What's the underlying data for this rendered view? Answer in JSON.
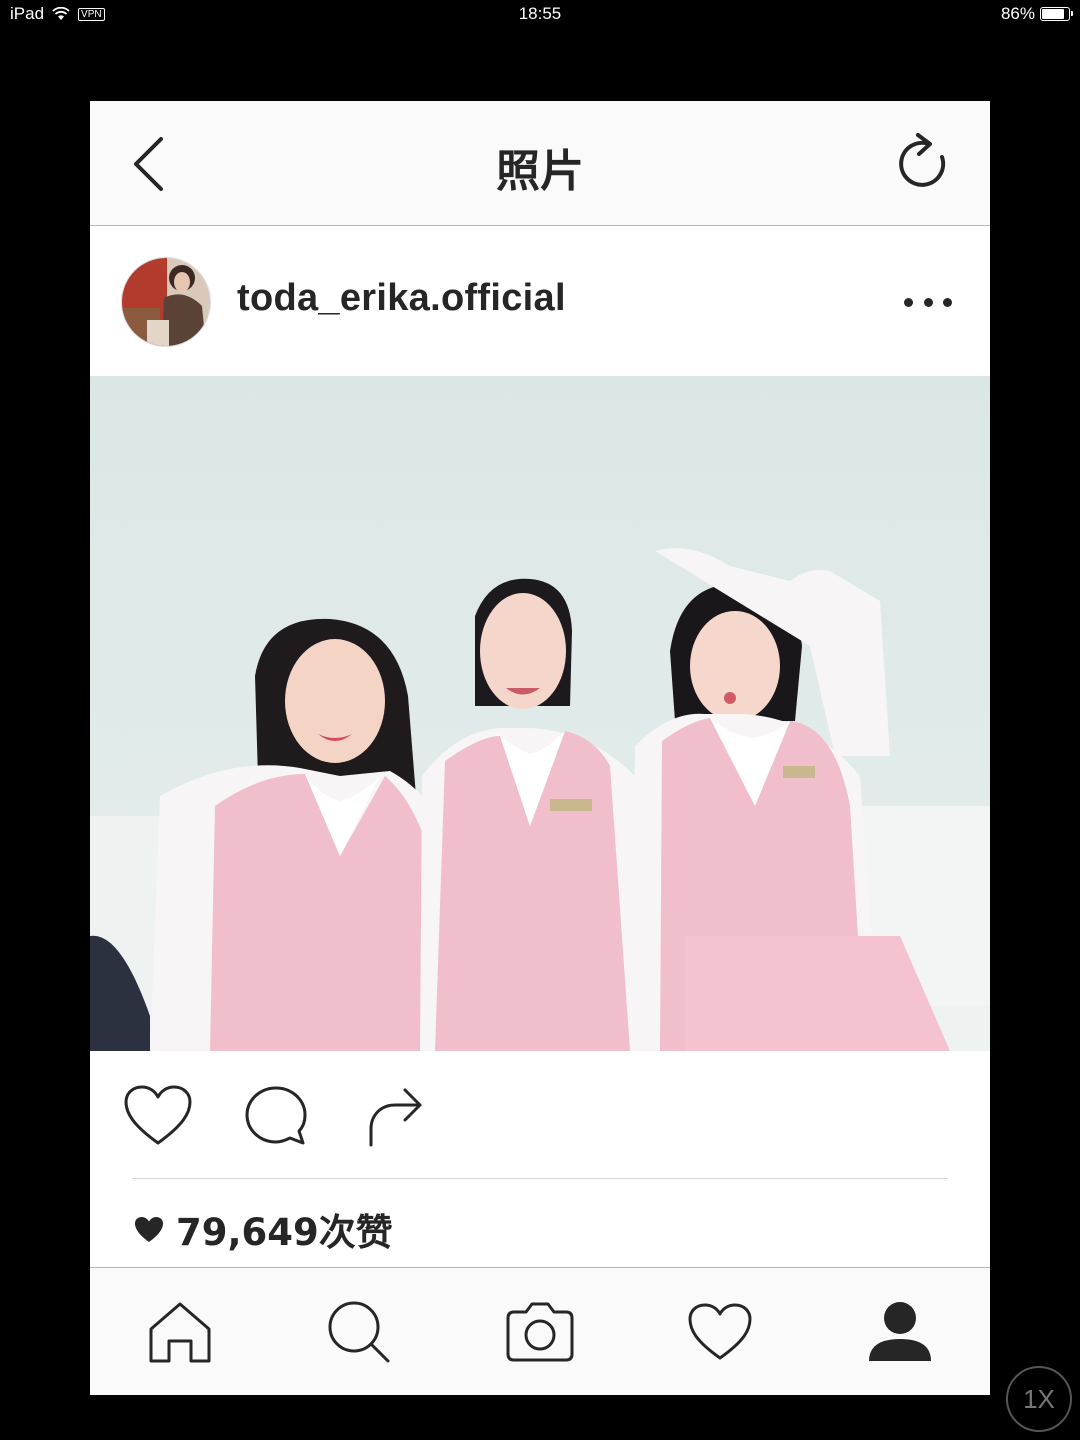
{
  "status_bar": {
    "device": "iPad",
    "vpn": "VPN",
    "time": "18:55",
    "battery": "86%",
    "battery_level": 0.86
  },
  "nav": {
    "title": "照片",
    "back_icon": "chevron-left-icon",
    "refresh_icon": "refresh-icon"
  },
  "post": {
    "username": "toda_erika.official",
    "avatar_icon": "profile-photo",
    "more_icon": "ellipsis-icon",
    "photo_description": "Photo of three women in pink vests and white blouses seated against a pale wall"
  },
  "actions": {
    "like_icon": "heart-outline-icon",
    "comment_icon": "comment-bubble-icon",
    "share_icon": "share-arrow-icon"
  },
  "likes": {
    "text": "79,649次赞",
    "icon": "heart-filled-icon"
  },
  "tab_bar": {
    "items": [
      "home-icon",
      "search-icon",
      "camera-icon",
      "activity-heart-icon",
      "profile-icon"
    ]
  },
  "overlay": {
    "speed": "1X"
  },
  "colors": {
    "frame_bg": "#ffffff",
    "bar_bg": "#fafafa",
    "text": "#262626",
    "vest_pink": "#f1bfcb"
  }
}
